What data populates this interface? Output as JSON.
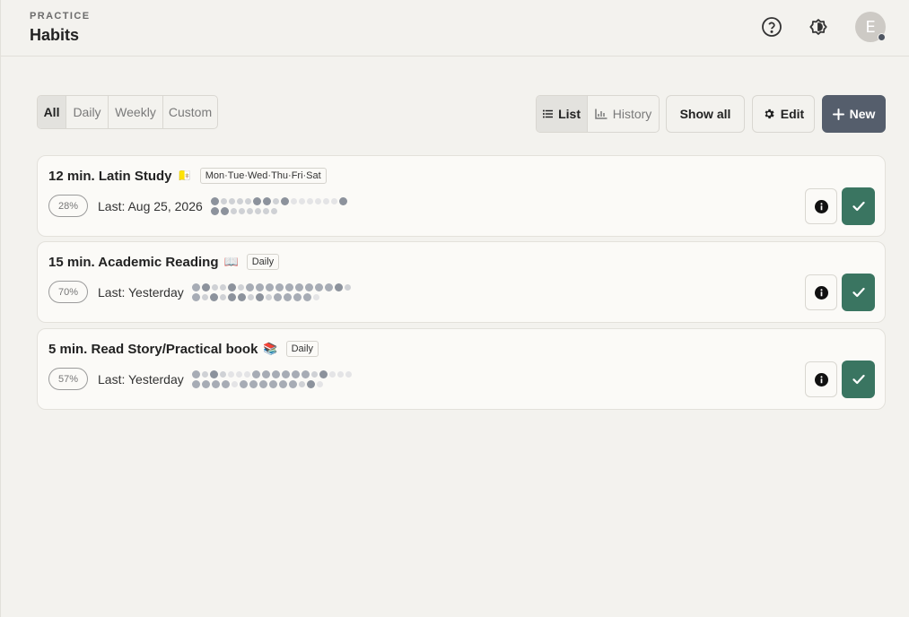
{
  "header": {
    "eyebrow": "PRACTICE",
    "title": "Habits",
    "avatar_initial": "E"
  },
  "filters": {
    "tabs": [
      "All",
      "Daily",
      "Weekly",
      "Custom"
    ],
    "active": "All"
  },
  "view_toggle": {
    "list_label": "List",
    "history_label": "History",
    "active": "List"
  },
  "toolbar": {
    "show_all_label": "Show all",
    "edit_label": "Edit",
    "new_label": "New"
  },
  "colors": {
    "accent_green": "#3a7561",
    "primary_slate": "#555e6c"
  },
  "habits": [
    {
      "name": "12 min. Latin Study",
      "emoji": "🇻🇦",
      "frequency": "Mon·Tue·Wed·Thu·Fri·Sat",
      "percent": "28%",
      "last": "Last: Aug 25, 2026",
      "history": [
        [
          3,
          1,
          1,
          1,
          1,
          3,
          3,
          1,
          3,
          0,
          0,
          0,
          0,
          0,
          0,
          3
        ],
        [
          3,
          3,
          1,
          1,
          1,
          1,
          1,
          1
        ]
      ]
    },
    {
      "name": "15 min. Academic Reading",
      "emoji": "📖",
      "frequency": "Daily",
      "percent": "70%",
      "last": "Last: Yesterday",
      "history": [
        [
          2,
          3,
          1,
          1,
          3,
          1,
          2,
          2,
          2,
          2,
          2,
          2,
          2,
          2,
          2,
          3,
          1
        ],
        [
          2,
          1,
          3,
          1,
          3,
          3,
          1,
          3,
          1,
          2,
          2,
          2,
          2,
          0
        ]
      ]
    },
    {
      "name": "5 min. Read Story/Practical book",
      "emoji": "📚",
      "frequency": "Daily",
      "percent": "57%",
      "last": "Last: Yesterday",
      "history": [
        [
          2,
          1,
          3,
          1,
          0,
          0,
          0,
          2,
          2,
          2,
          2,
          2,
          2,
          1,
          3,
          0,
          0,
          0
        ],
        [
          2,
          2,
          2,
          2,
          0,
          2,
          2,
          2,
          2,
          2,
          2,
          1,
          3,
          0
        ]
      ]
    }
  ]
}
